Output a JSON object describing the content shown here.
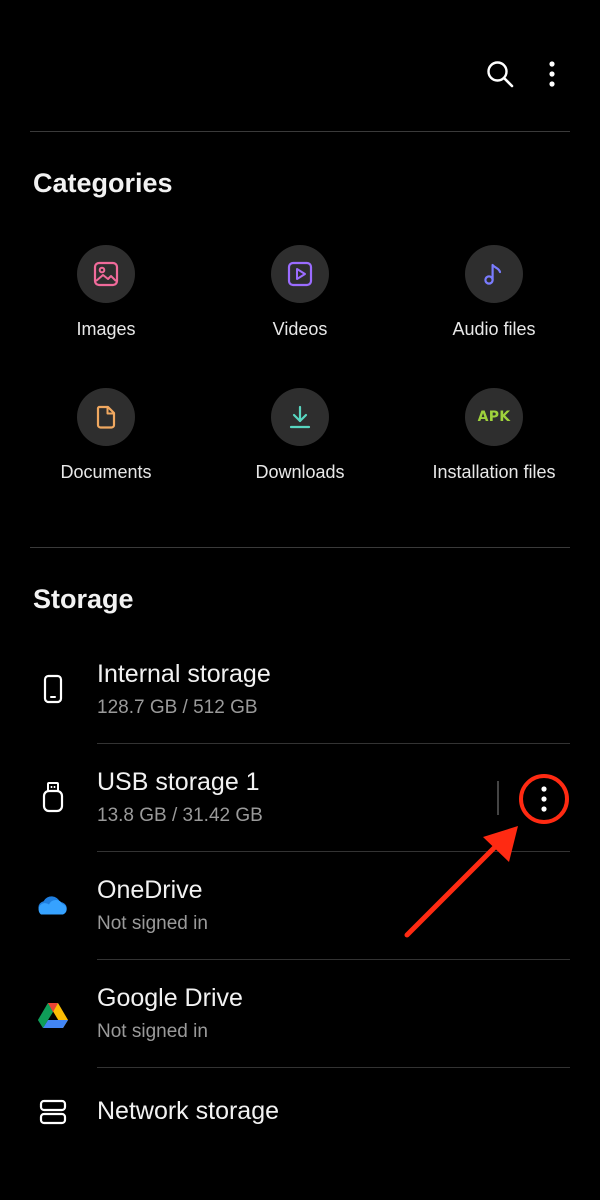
{
  "toolbar": {
    "search_icon": "search-icon",
    "more_icon": "more-vertical-icon"
  },
  "categories": {
    "title": "Categories",
    "items": [
      {
        "label": "Images",
        "icon": "image-icon",
        "color": "#f06a9a"
      },
      {
        "label": "Videos",
        "icon": "video-icon",
        "color": "#9b6cff"
      },
      {
        "label": "Audio files",
        "icon": "music-note-icon",
        "color": "#7a7cff"
      },
      {
        "label": "Documents",
        "icon": "document-icon",
        "color": "#f0a860"
      },
      {
        "label": "Downloads",
        "icon": "download-icon",
        "color": "#58d6c0"
      },
      {
        "label": "Installation files",
        "icon": "apk-icon",
        "icon_text": "APK",
        "color": "#9fd23c"
      }
    ]
  },
  "storage": {
    "title": "Storage",
    "items": [
      {
        "name": "Internal storage",
        "detail": "128.7 GB / 512 GB",
        "icon": "phone-icon"
      },
      {
        "name": "USB storage 1",
        "detail": "13.8 GB / 31.42 GB",
        "icon": "usb-drive-icon"
      },
      {
        "name": "OneDrive",
        "detail": "Not signed in",
        "icon": "onedrive-icon"
      },
      {
        "name": "Google Drive",
        "detail": "Not signed in",
        "icon": "google-drive-icon"
      },
      {
        "name": "Network storage",
        "icon": "network-storage-icon"
      }
    ]
  },
  "annotation": {
    "highlight_color": "#ff2a12"
  }
}
